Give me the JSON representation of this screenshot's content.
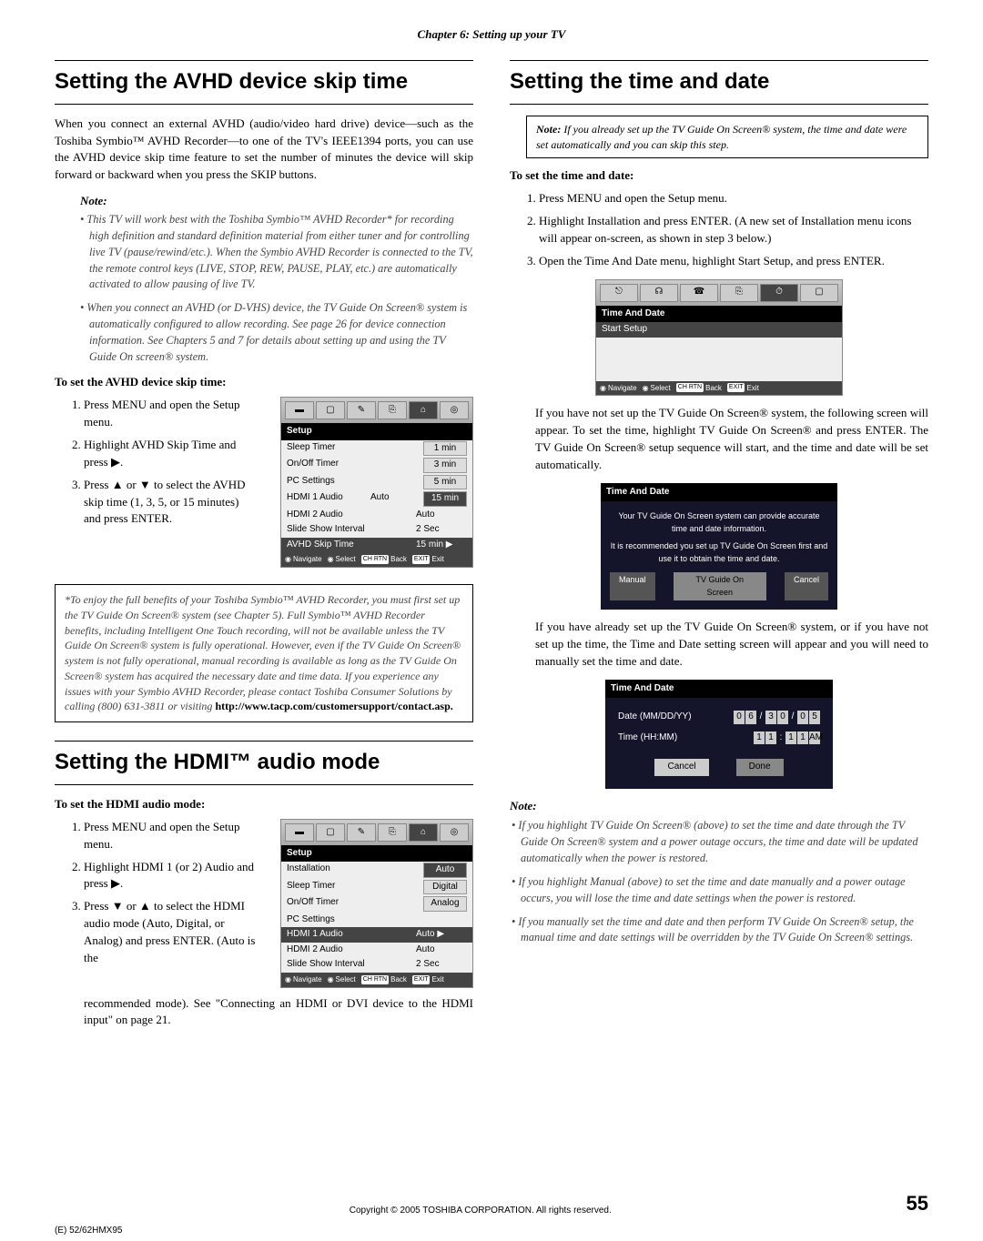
{
  "chapter": "Chapter 6: Setting up your TV",
  "left": {
    "h1": "Setting the AVHD device skip time",
    "intro": "When you connect an external AVHD (audio/video hard drive) device—such as the Toshiba Symbio™ AVHD Recorder—to one of the TV's IEEE1394 ports, you can use the AVHD device skip time feature to set the number of minutes the device will skip forward or backward when you press the SKIP buttons.",
    "note_label": "Note:",
    "note1": "This TV will work best with the Toshiba Symbio™ AVHD Recorder* for recording high definition and standard definition material from either tuner and for controlling live TV (pause/rewind/etc.). When the Symbio AVHD Recorder is connected to the TV, the remote control keys (LIVE, STOP, REW, PAUSE, PLAY, etc.) are automatically activated to allow pausing of live TV.",
    "note2": "When you connect an AVHD (or D-VHS) device, the TV Guide On Screen® system is automatically configured to allow recording. See page 26 for device connection information. See Chapters 5 and 7 for details about setting up and using the TV Guide On screen® system.",
    "sub1": "To set the AVHD device skip time:",
    "steps1": [
      "Press MENU and open the Setup menu.",
      "Highlight AVHD Skip Time and press ▶.",
      "Press ▲ or ▼ to select the AVHD skip time (1, 3, 5, or 15 minutes) and press ENTER."
    ],
    "osd1": {
      "title": "Setup",
      "rows": [
        {
          "l": "Sleep Timer",
          "m": "",
          "r": "1 min"
        },
        {
          "l": "On/Off Timer",
          "m": "",
          "r": "3 min"
        },
        {
          "l": "PC Settings",
          "m": "",
          "r": "5 min"
        },
        {
          "l": "HDMI 1 Audio",
          "m": "Auto",
          "r": "15 min",
          "rsel": true
        },
        {
          "l": "HDMI 2 Audio",
          "m": "Auto",
          "r": ""
        },
        {
          "l": "Slide Show Interval",
          "m": "2 Sec",
          "r": ""
        },
        {
          "l": "AVHD Skip Time",
          "m": "15 min ▶",
          "r": "",
          "sel": true
        }
      ],
      "nav": [
        "Navigate",
        "Select",
        "Back",
        "Exit"
      ]
    },
    "disc_body": "*To enjoy the full benefits of your Toshiba Symbio™ AVHD Recorder, you must first set up the TV Guide On Screen® system (see Chapter 5). Full Symbio™ AVHD Recorder benefits, including Intelligent One Touch recording, will not be available unless the TV Guide On Screen® system is fully operational. However, even if the TV Guide On Screen® system is not fully operational, manual recording is available as long as the TV Guide On Screen® system has acquired the necessary date and time data. If you experience any issues with your Symbio AVHD Recorder, please contact Toshiba Consumer Solutions by calling (800) 631-3811 or visiting ",
    "disc_link": "http://www.tacp.com/customersupport/contact.asp.",
    "h2": "Setting the HDMI™ audio mode",
    "sub2": "To set the HDMI audio mode:",
    "steps2": [
      "Press MENU and open the Setup menu.",
      "Highlight HDMI 1 (or 2) Audio and press ▶.",
      "Press ▼ or ▲ to select the HDMI audio mode (Auto, Digital, or Analog) and press ENTER. (Auto is the"
    ],
    "step2_cont": "recommended mode). See \"Connecting an HDMI or DVI device to the HDMI input\" on page 21.",
    "osd2": {
      "title": "Setup",
      "rows": [
        {
          "l": "Installation",
          "m": "",
          "r": "Auto",
          "rsel": true
        },
        {
          "l": "Sleep Timer",
          "m": "",
          "r": "Digital"
        },
        {
          "l": "On/Off Timer",
          "m": "",
          "r": "Analog"
        },
        {
          "l": "PC Settings",
          "m": "",
          "r": ""
        },
        {
          "l": "HDMI 1 Audio",
          "m": "Auto ▶",
          "r": "",
          "sel": true
        },
        {
          "l": "HDMI 2 Audio",
          "m": "Auto",
          "r": ""
        },
        {
          "l": "Slide Show Interval",
          "m": "2 Sec",
          "r": ""
        }
      ],
      "nav": [
        "Navigate",
        "Select",
        "Back",
        "Exit"
      ]
    }
  },
  "right": {
    "h1": "Setting the time and date",
    "note_box_label": "Note:",
    "note_box": " If you already set up the TV Guide On Screen® system, the time and date were set automatically and you can skip this step.",
    "sub": "To set the time and date:",
    "steps": [
      "Press MENU and open the Setup menu.",
      "Highlight Installation and press ENTER. (A new set of Installation menu icons will appear on-screen, as shown in step 3 below.)",
      "Open the Time And Date menu, highlight Start Setup, and press ENTER."
    ],
    "osd1": {
      "title": "Time And Date",
      "item": "Start Setup",
      "nav": [
        "Navigate",
        "Select",
        "Back",
        "Exit"
      ]
    },
    "p1": "If you have not set up the TV Guide On Screen® system, the following screen will appear. To set the time, highlight TV Guide On Screen® and press ENTER. The TV Guide On Screen® setup sequence will start, and the time and date will be set automatically.",
    "osd2": {
      "title": "Time And Date",
      "l1": "Your TV Guide On Screen system can provide accurate time and date information.",
      "l2": "It is recommended you set up TV Guide On Screen first and use it to obtain the time and date.",
      "btns": [
        "Manual",
        "TV Guide On Screen",
        "Cancel"
      ]
    },
    "p2": "If you have already set up the TV Guide On Screen® system, or if you have not set up the time, the Time and Date setting screen will appear and you will need to manually set the time and date.",
    "osd3": {
      "title": "Time And Date",
      "date_label": "Date (MM/DD/YY)",
      "date": [
        "0",
        "6",
        "/",
        "3",
        "0",
        "/",
        "0",
        "5"
      ],
      "time_label": "Time (HH:MM)",
      "time": [
        "1",
        "1",
        ":",
        "1",
        "1",
        "AM"
      ],
      "btns": [
        "Cancel",
        "Done"
      ]
    },
    "note_head": "Note:",
    "nb1": "If you highlight TV Guide On Screen® (above) to set the time and date through the TV Guide On Screen® system and a power outage occurs, the time and date will be updated automatically when the power is restored.",
    "nb2": "If you highlight Manual (above) to set the time and date manually and a power outage occurs, you will lose the time and date settings when the power is restored.",
    "nb3": "If you manually set the time and date and then perform TV Guide On Screen® setup, the manual time and date settings will be overridden by the TV Guide On Screen® settings."
  },
  "footer": {
    "copy": "Copyright © 2005 TOSHIBA CORPORATION. All rights reserved.",
    "page": "55",
    "crop": "(E) 52/62HMX95"
  }
}
